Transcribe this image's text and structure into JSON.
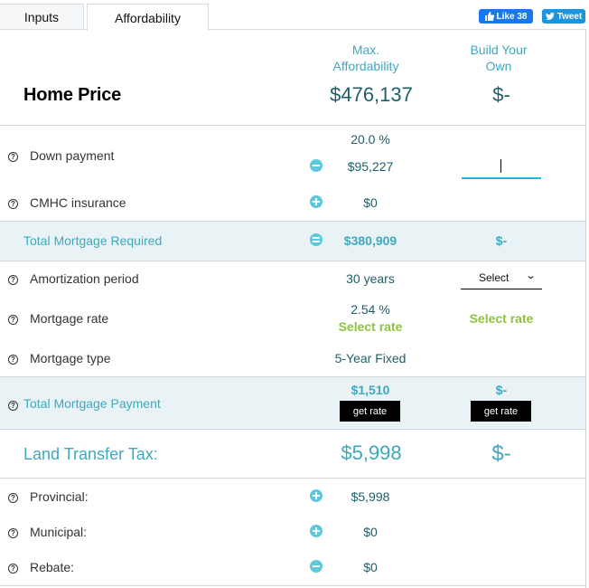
{
  "tabs": [
    {
      "label": "Inputs",
      "active": false
    },
    {
      "label": "Affordability",
      "active": true
    }
  ],
  "social": {
    "like_label": "Like 38",
    "tweet_label": "Tweet",
    "like_color": "#1877f2",
    "tweet_color": "#1b95e0"
  },
  "columns": {
    "max_affordability": "Max. Affordability",
    "max_line1": "Max.",
    "max_line2": "Affordability",
    "build_line1": "Build Your",
    "build_line2": "Own"
  },
  "home_price": {
    "label": "Home Price",
    "max": "$476,137",
    "build": "$-"
  },
  "down_payment": {
    "label": "Down payment",
    "percent": "20.0 %",
    "max": "$95,227",
    "operator": "minus",
    "build_input_value": ""
  },
  "cmhc": {
    "label": "CMHC insurance",
    "operator": "plus",
    "max": "$0"
  },
  "total_mortgage_required": {
    "label": "Total Mortgage Required",
    "operator": "equals",
    "max": "$380,909",
    "build": "$-"
  },
  "amortization": {
    "label": "Amortization period",
    "max": "30 years",
    "build_select": "Select"
  },
  "mortgage_rate": {
    "label": "Mortgage rate",
    "max_rate": "2.54 %",
    "max_link": "Select rate",
    "build_link": "Select rate"
  },
  "mortgage_type": {
    "label": "Mortgage type",
    "max": "5-Year Fixed"
  },
  "total_mortgage_payment": {
    "label": "Total Mortgage Payment",
    "max": "$1,510",
    "build": "$-",
    "button_label": "get rate"
  },
  "land_transfer_tax": {
    "label": "Land Transfer Tax:",
    "max": "$5,998",
    "build": "$-"
  },
  "provincial": {
    "label": "Provincial:",
    "operator": "plus",
    "max": "$5,998"
  },
  "municipal": {
    "label": "Municipal:",
    "operator": "plus",
    "max": "$0"
  },
  "rebate": {
    "label": "Rebate:",
    "operator": "minus",
    "max": "$0"
  },
  "help_glyph": "?",
  "colors": {
    "teal": "#3ea9be",
    "value_dark_teal": "#1e5e68",
    "green_link": "#8dc33f",
    "operator_circle": "#5cc8dc",
    "shaded_row": "#e9f2f5"
  }
}
